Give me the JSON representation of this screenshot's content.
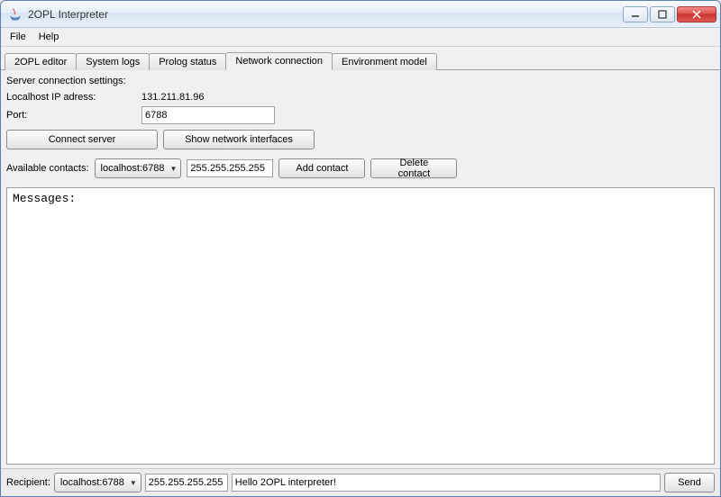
{
  "window": {
    "title": "2OPL Interpreter"
  },
  "menubar": {
    "items": [
      "File",
      "Help"
    ]
  },
  "tabs": {
    "items": [
      "2OPL editor",
      "System logs",
      "Prolog status",
      "Network connection",
      "Environment model"
    ],
    "active_index": 3
  },
  "settings": {
    "heading": "Server connection settings:",
    "ip_label": "Localhost IP adress:",
    "ip_value": "131.211.81.96",
    "port_label": "Port:",
    "port_value": "6788",
    "connect_label": "Connect server",
    "show_ifaces_label": "Show network interfaces"
  },
  "contacts": {
    "label": "Available contacts:",
    "selected": "localhost:6788",
    "ip_value": "255.255.255.255",
    "add_label": "Add contact",
    "delete_label": "Delete contact"
  },
  "messages": {
    "header": "Messages:"
  },
  "bottom": {
    "recipient_label": "Recipient:",
    "recipient_selected": "localhost:6788",
    "recipient_ip": "255.255.255.255",
    "message_value": "Hello 2OPL interpreter!",
    "send_label": "Send"
  }
}
